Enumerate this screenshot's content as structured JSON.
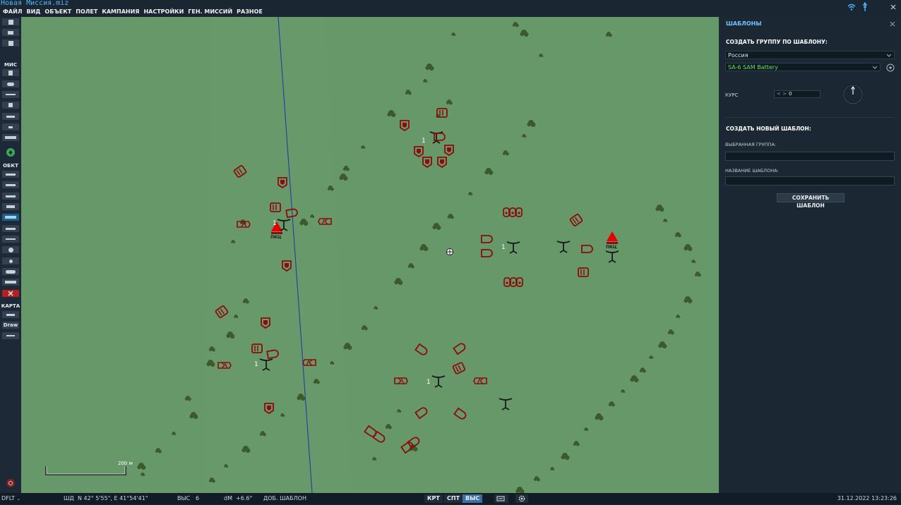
{
  "window": {
    "title": "Новая Миссия.miz"
  },
  "menu": {
    "items": [
      "ФАЙЛ",
      "ВИД",
      "ОБЪЕКТ",
      "ПОЛЕТ",
      "КАМПАНИЯ",
      "НАСТРОЙКИ",
      "ГЕН. МИССИЙ",
      "РАЗНОЕ"
    ]
  },
  "toolbar": {
    "section_mission": "МИС",
    "section_objects": "ОБКТ",
    "section_map": "КАРТА",
    "draw_label": "Draw"
  },
  "map": {
    "scale_label": "200 м",
    "group_number_label": "1",
    "unit_labels": {
      "sam_1": "ПКЦ",
      "sam_2": "ПКЦ"
    },
    "colors": {
      "terrain": "#67986a",
      "units": "#8f0a0a",
      "sam_marker": "#e60000",
      "trees": "#3d5a2c",
      "border_line": "#2a3a9e"
    }
  },
  "panel": {
    "title": "ШАБЛОНЫ",
    "create_by_template_heading": "СОЗДАТЬ ГРУППУ ПО ШАБЛОНУ:",
    "country_value": "Россия",
    "template_value": "SA-6 SAM Battery",
    "course_label": "КУРС",
    "course_value": "0",
    "course_arrows": "< >",
    "create_new_heading": "СОЗДАТЬ НОВЫЙ ШАБЛОН:",
    "selected_group_label": "ВЫБРАННАЯ ГРУППА:",
    "selected_group_value": "",
    "template_name_label": "НАЗВАНИЕ ШАБЛОНА:",
    "template_name_value": "",
    "save_button": "СОХРАНИТЬ ШАБЛОН"
  },
  "statusbar": {
    "profile": "DFLT",
    "coords_label": "ШД",
    "coords_value": "N 42° 5'55\", E 41°54'41\"",
    "alt_label": "ВЫС",
    "alt_value": "6",
    "dm_label": "dM",
    "dm_value": "+6.6°",
    "mode_text": "ДОБ. ШАБЛОН",
    "btn_krt": "КРТ",
    "btn_spt": "СПТ",
    "btn_vys": "ВЫС",
    "datetime": "31.12.2022 13:23:26"
  }
}
